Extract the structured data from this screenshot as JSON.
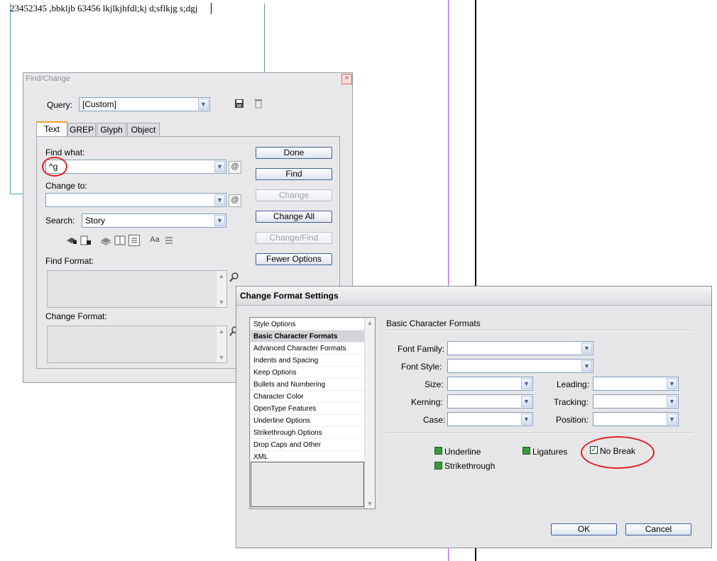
{
  "document": {
    "text": "23452345 ,bbkljb 63456 lkjlkjhfdl;kj d;sflkjg s;dgj"
  },
  "find_change": {
    "title": "Find/Change",
    "close_glyph": "×",
    "query_label": "Query:",
    "query_value": "[Custom]",
    "tabs": [
      "Text",
      "GREP",
      "Glyph",
      "Object"
    ],
    "find_what_label": "Find what:",
    "find_what_value": "^g",
    "change_to_label": "Change to:",
    "change_to_value": "",
    "search_label": "Search:",
    "search_value": "Story",
    "find_format_label": "Find Format:",
    "change_format_label": "Change Format:",
    "buttons": {
      "done": "Done",
      "find": "Find",
      "change": "Change",
      "change_all": "Change All",
      "change_find": "Change/Find",
      "fewer_options": "Fewer Options"
    },
    "option_icons": [
      "locked-layers-icon",
      "locked-stories-icon",
      "hidden-layers-icon",
      "master-pages-icon",
      "footnotes-icon",
      "case-sensitive-icon",
      "whole-word-icon"
    ],
    "case_glyph": "Aa",
    "special_char_glyph": "@"
  },
  "change_format": {
    "title": "Change Format Settings",
    "categories": [
      "Style Options",
      "Basic Character Formats",
      "Advanced Character Formats",
      "Indents and Spacing",
      "Keep Options",
      "Bullets and Numbering",
      "Character Color",
      "OpenType Features",
      "Underline Options",
      "Strikethrough Options",
      "Drop Caps and Other",
      "XML"
    ],
    "selected_category": "Basic Character Formats",
    "section_title": "Basic Character Formats",
    "labels": {
      "font_family": "Font Family:",
      "font_style": "Font Style:",
      "size": "Size:",
      "leading": "Leading:",
      "kerning": "Kerning:",
      "tracking": "Tracking:",
      "case": "Case:",
      "position": "Position:"
    },
    "checkboxes": {
      "underline": "Underline",
      "ligatures": "Ligatures",
      "no_break": "No Break",
      "strikethrough": "Strikethrough"
    },
    "ok": "OK",
    "cancel": "Cancel"
  },
  "colors": {
    "accent_tab": "#f0a030",
    "annotation": "#e02020",
    "guide": "#c040c0"
  }
}
